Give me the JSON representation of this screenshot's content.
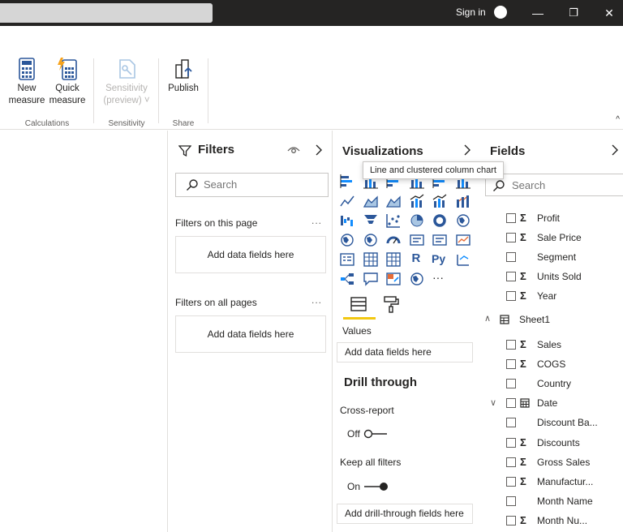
{
  "titlebar": {
    "signin": "Sign in",
    "minimize_glyph": "—",
    "restore_glyph": "❐",
    "close_glyph": "✕"
  },
  "ribbon": {
    "new_measure": {
      "line1": "New",
      "line2": "measure"
    },
    "quick_measure": {
      "line1": "Quick",
      "line2": "measure"
    },
    "sensitivity": {
      "line1": "Sensitivity",
      "line2": "(preview) ˅"
    },
    "publish": {
      "line1": "Publish"
    },
    "groups": {
      "calculations": "Calculations",
      "sensitivity": "Sensitivity",
      "share": "Share"
    },
    "collapse_glyph": "^"
  },
  "filters": {
    "title": "Filters",
    "search_placeholder": "Search",
    "on_this_page": "Filters on this page",
    "on_all_pages": "Filters on all pages",
    "more": "...",
    "add_fields": "Add data fields here"
  },
  "visualizations": {
    "title": "Visualizations",
    "tooltip": "Line and clustered column chart",
    "icons": [
      "stacked-bar-chart-icon",
      "stacked-column-chart-icon",
      "clustered-bar-chart-icon",
      "clustered-column-chart-icon",
      "100-stacked-bar-chart-icon",
      "100-stacked-column-chart-icon",
      "line-chart-icon",
      "area-chart-icon",
      "stacked-area-chart-icon",
      "line-stacked-column-chart-icon",
      "line-clustered-column-chart-icon",
      "ribbon-chart-icon",
      "waterfall-chart-icon",
      "funnel-chart-icon",
      "scatter-chart-icon",
      "pie-chart-icon",
      "donut-chart-icon",
      "treemap-icon",
      "map-icon",
      "filled-map-icon",
      "gauge-icon",
      "card-icon",
      "multi-row-card-icon",
      "kpi-icon",
      "slicer-icon",
      "table-icon",
      "matrix-icon",
      "r-visual-icon",
      "python-visual-icon",
      "key-influencers-icon",
      "decomposition-tree-icon",
      "qa-icon",
      "smart-narrative-icon",
      "arcgis-map-icon",
      "more-visuals-icon"
    ],
    "r_label": "R",
    "py_label": "Py",
    "more_label": "···",
    "values_label": "Values",
    "add_fields": "Add data fields here",
    "drill_through": "Drill through",
    "cross_report": "Cross-report",
    "cross_report_state": "Off",
    "keep_all_filters": "Keep all filters",
    "keep_all_filters_state": "On",
    "add_drill_fields": "Add drill-through fields here"
  },
  "fields": {
    "title": "Fields",
    "search_placeholder": "Search",
    "items": [
      {
        "label": "Profit",
        "sigma": true
      },
      {
        "label": "Sale Price",
        "sigma": true
      },
      {
        "label": "Segment",
        "sigma": false
      },
      {
        "label": "Units Sold",
        "sigma": true
      },
      {
        "label": "Year",
        "sigma": true
      }
    ],
    "table_name": "Sheet1",
    "table_items": [
      {
        "label": "Sales",
        "sigma": true
      },
      {
        "label": "COGS",
        "sigma": true
      },
      {
        "label": "Country",
        "sigma": false
      },
      {
        "label": "Date",
        "sigma": false
      },
      {
        "label": "Discount Ba...",
        "sigma": false
      },
      {
        "label": "Discounts",
        "sigma": true
      },
      {
        "label": "Gross Sales",
        "sigma": true
      },
      {
        "label": "Manufactur...",
        "sigma": true
      },
      {
        "label": "Month Name",
        "sigma": false
      },
      {
        "label": "Month Nu...",
        "sigma": true
      }
    ],
    "sigma_glyph": "Σ"
  },
  "colors": {
    "titlebar": "#252423",
    "accent_yellow": "#f2c811",
    "icon_blue": "#2b579a",
    "icon_teal": "#118dff"
  }
}
